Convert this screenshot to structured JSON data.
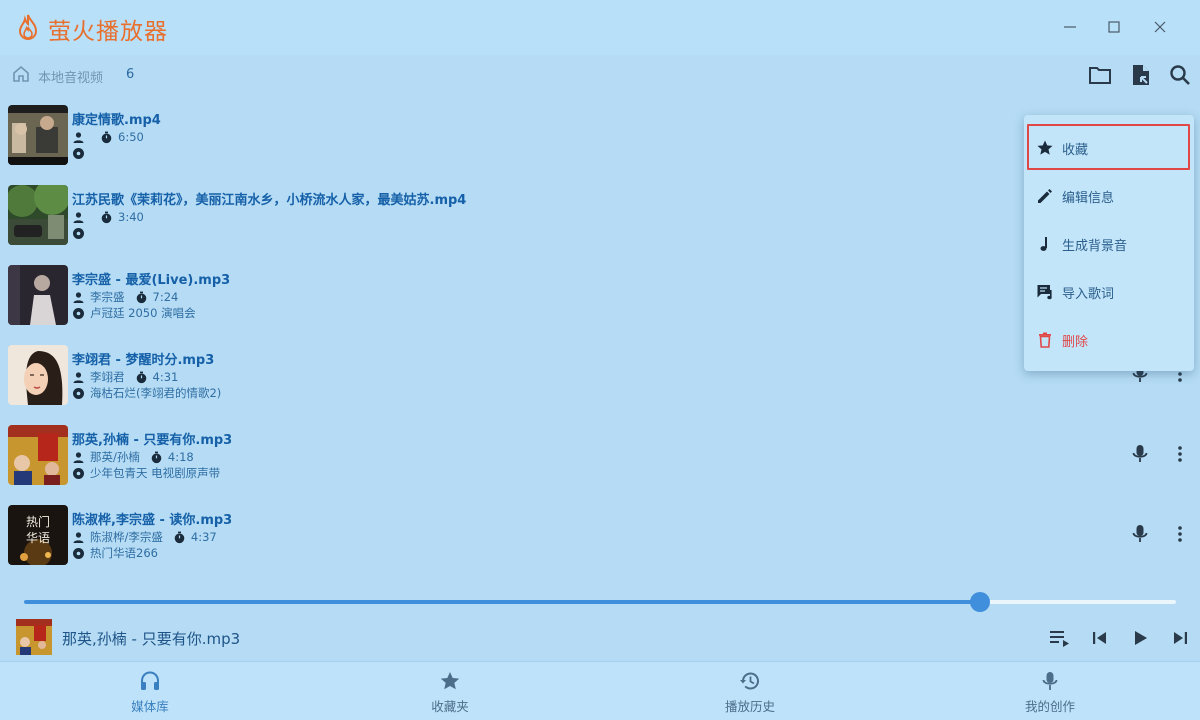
{
  "app": {
    "title": "萤火播放器",
    "accent": "#e8702f"
  },
  "window_controls": {
    "minimize_icon": "minimize-icon",
    "maximize_icon": "maximize-icon",
    "close_icon": "close-icon"
  },
  "toolbar": {
    "location_label": "本地音视频",
    "item_count": "6",
    "icons": [
      "folder-icon",
      "file-import-icon",
      "search-icon"
    ]
  },
  "tracks": [
    {
      "title": "康定情歌.mp4",
      "artist": "",
      "duration": "6:50",
      "album": "",
      "cover": "video-scene"
    },
    {
      "title": "江苏民歌《茉莉花》，美丽江南水乡，小桥流水人家，最美姑苏.mp4",
      "artist": "",
      "duration": "3:40",
      "album": "",
      "cover": "video-outdoor"
    },
    {
      "title": "李宗盛 - 最爱(Live).mp3",
      "artist": "李宗盛",
      "duration": "7:24",
      "album": "卢冠廷 2050 演唱会",
      "cover": "concert"
    },
    {
      "title": "李翊君 - 梦醒时分.mp3",
      "artist": "李翊君",
      "duration": "4:31",
      "album": "海枯石烂(李翊君的情歌2)",
      "cover": "portrait"
    },
    {
      "title": "那英,孙楠 - 只要有你.mp3",
      "artist": "那英/孙楠",
      "duration": "4:18",
      "album": "少年包青天 电视剧原声带",
      "cover": "tv-ost"
    },
    {
      "title": "陈淑桦,李宗盛 - 读你.mp3",
      "artist": "陈淑桦/李宗盛",
      "duration": "4:37",
      "album": "热门华语266",
      "cover": "hot-chinese"
    }
  ],
  "cover_texts": {
    "hot_chinese_line1": "热门",
    "hot_chinese_line2": "华语"
  },
  "context_menu": {
    "items": [
      {
        "label": "收藏",
        "icon": "star-icon",
        "highlighted": true
      },
      {
        "label": "编辑信息",
        "icon": "pencil-icon"
      },
      {
        "label": "生成背景音",
        "icon": "music-note-icon"
      },
      {
        "label": "导入歌词",
        "icon": "lyrics-import-icon"
      },
      {
        "label": "删除",
        "icon": "trash-icon",
        "color": "#e04848"
      }
    ]
  },
  "player": {
    "now_playing": "那英,孙楠 - 只要有你.mp3",
    "progress": 0.83,
    "controls": [
      "playlist-icon",
      "previous-icon",
      "play-icon",
      "next-icon"
    ]
  },
  "bottom_nav": [
    {
      "label": "媒体库",
      "icon": "headphones-icon",
      "active": true
    },
    {
      "label": "收藏夹",
      "icon": "star-icon"
    },
    {
      "label": "播放历史",
      "icon": "history-icon"
    },
    {
      "label": "我的创作",
      "icon": "microphone-icon"
    }
  ]
}
